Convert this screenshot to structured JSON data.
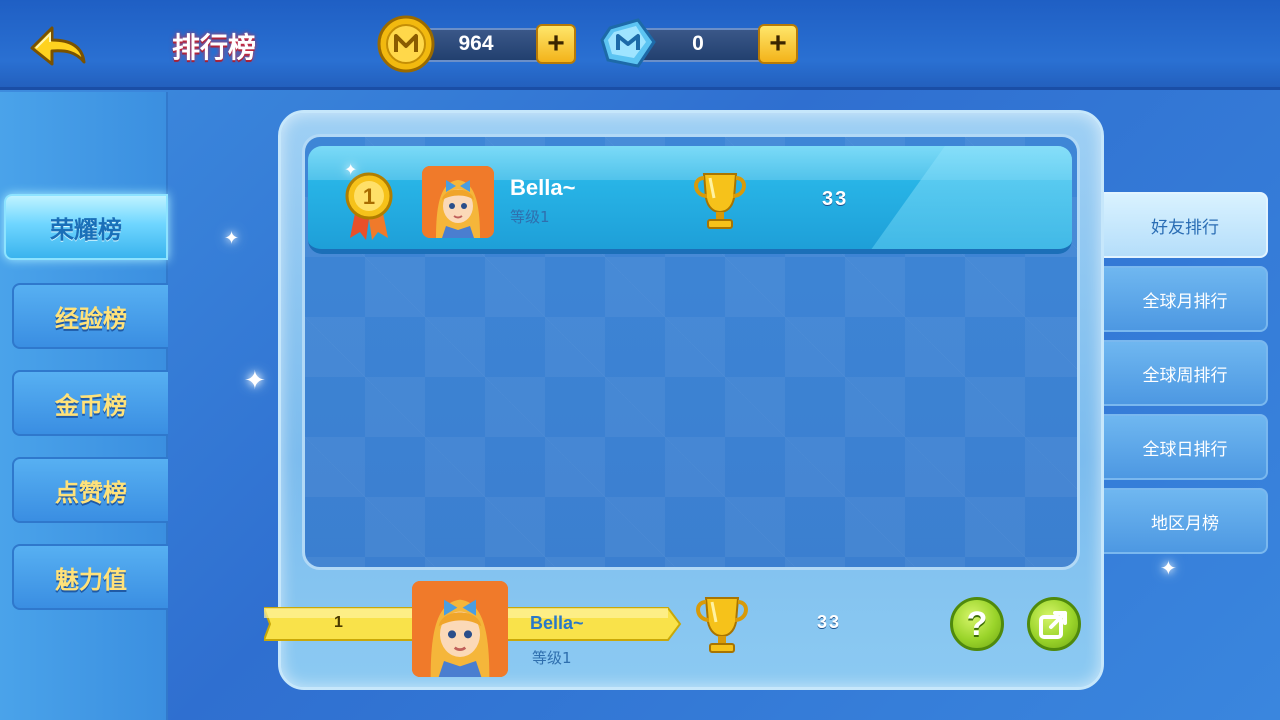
{
  "header": {
    "title": "排行榜",
    "coins": {
      "value": "964",
      "plus": "+"
    },
    "gems": {
      "value": "0",
      "plus": "+"
    }
  },
  "left_tabs": [
    {
      "label": "荣耀榜",
      "active": true
    },
    {
      "label": "经验榜",
      "active": false
    },
    {
      "label": "金币榜",
      "active": false
    },
    {
      "label": "点赞榜",
      "active": false
    },
    {
      "label": "魅力值",
      "active": false
    }
  ],
  "right_tabs": [
    {
      "label": "好友排行",
      "active": true
    },
    {
      "label": "全球月排行",
      "active": false
    },
    {
      "label": "全球周排行",
      "active": false
    },
    {
      "label": "全球日排行",
      "active": false
    },
    {
      "label": "地区月榜",
      "active": false
    }
  ],
  "ranking_rows": [
    {
      "rank": "1",
      "name": "Bella~",
      "level": "等级1",
      "score": "33"
    }
  ],
  "self_row": {
    "rank": "1",
    "name": "Bella~",
    "level": "等级1",
    "score": "33"
  },
  "buttons": {
    "help": "?"
  },
  "icons": {
    "back": "back-arrow-icon",
    "coin": "coin-icon",
    "gem": "gem-icon",
    "medal": "gold-medal-icon",
    "trophy": "trophy-icon",
    "share": "share-icon"
  },
  "colors": {
    "accent_yellow": "#f3b31a",
    "tab_text": "#ffe27a",
    "row_blue": "#1e9fd8",
    "button_green": "#9ad42a"
  }
}
